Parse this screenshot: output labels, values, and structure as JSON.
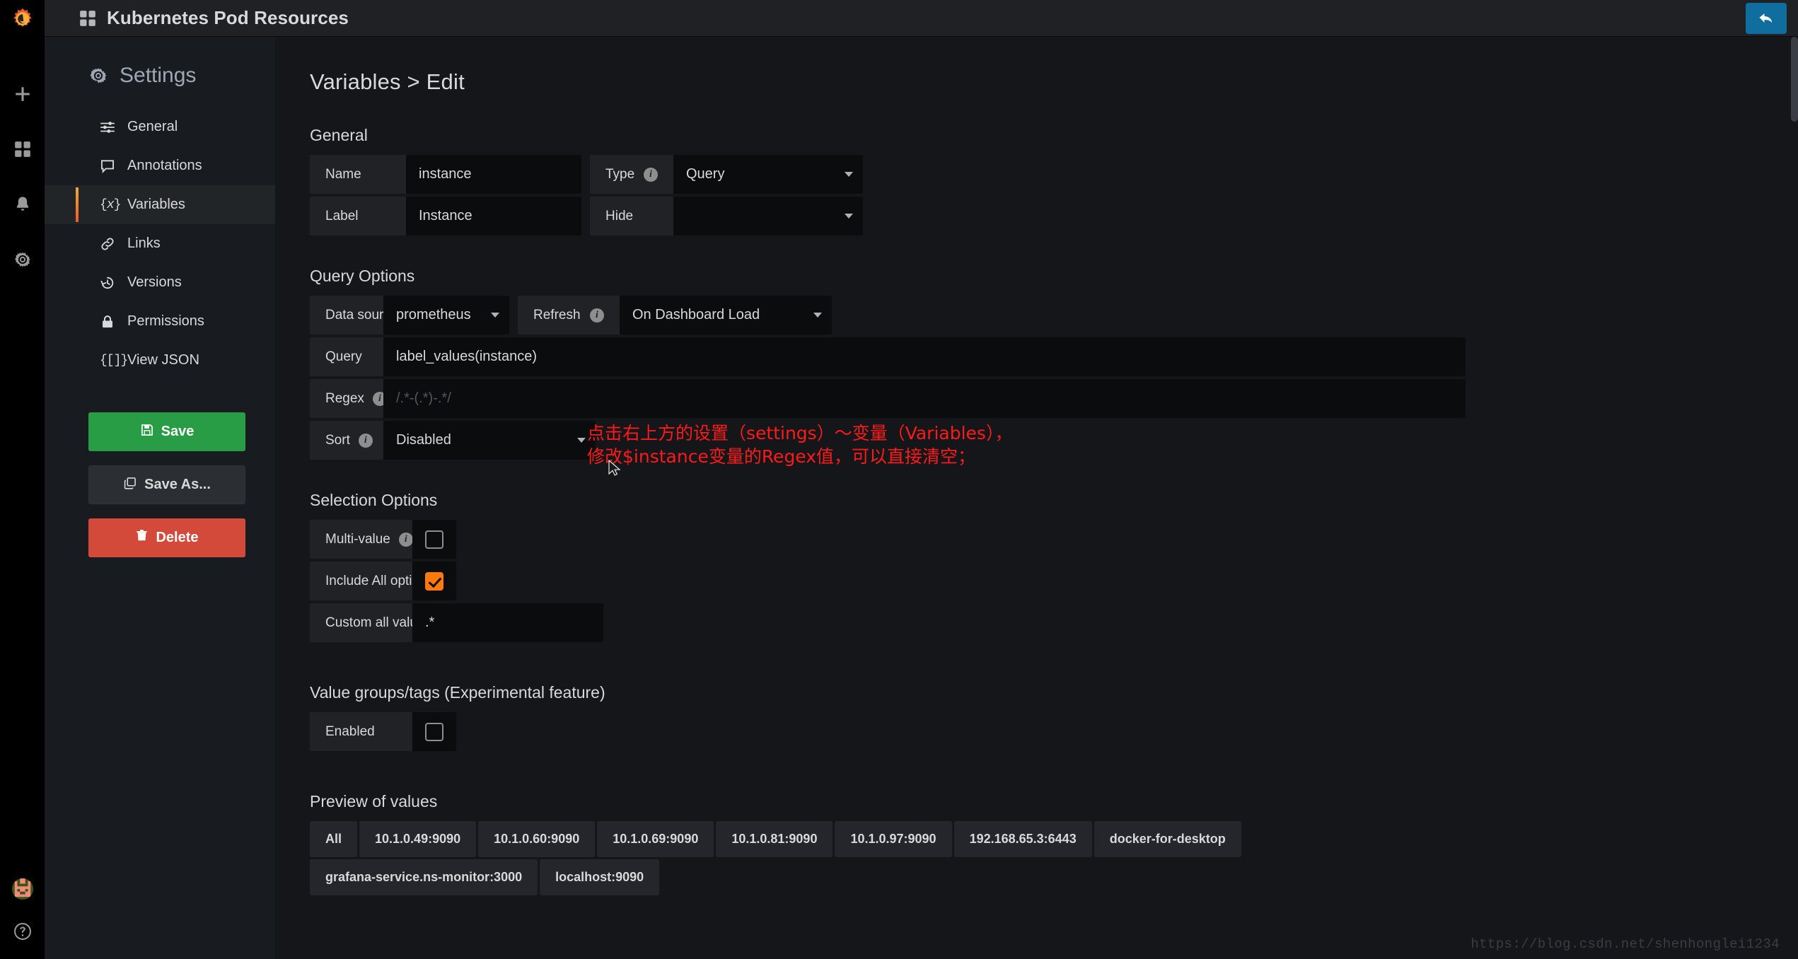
{
  "colors": {
    "accent_orange": "#ff780a",
    "save_green": "#299c46",
    "delete_red": "#d44a3a",
    "back_blue": "#0f6e9e",
    "annotation_red": "#ff1a1a",
    "panel_bg": "#141619",
    "field_bg": "#0b0c0e"
  },
  "rail": {
    "logo_name": "grafana-logo-icon",
    "items": [
      {
        "name": "create-add-icon",
        "label": "Create"
      },
      {
        "name": "dashboards-grid-icon",
        "label": "Dashboards"
      },
      {
        "name": "alerting-bell-icon",
        "label": "Alerting"
      },
      {
        "name": "configuration-gear-icon",
        "label": "Configuration"
      }
    ],
    "bottom": [
      {
        "name": "user-avatar",
        "label": "User profile"
      },
      {
        "name": "help-question-icon",
        "label": "Help"
      }
    ]
  },
  "topbar": {
    "dashboard_icon": "dashboard-grid-icon",
    "title": "Kubernetes Pod Resources",
    "back_button_label": "Go back to dashboard",
    "back_icon": "back-arrow-icon"
  },
  "sidebar": {
    "heading": "Settings",
    "heading_icon": "gear-icon",
    "items": [
      {
        "label": "General",
        "icon": "sliders-icon",
        "active": false
      },
      {
        "label": "Annotations",
        "icon": "comment-icon",
        "active": false
      },
      {
        "label": "Variables",
        "icon": "variable-icon",
        "active": true
      },
      {
        "label": "Links",
        "icon": "link-icon",
        "active": false
      },
      {
        "label": "Versions",
        "icon": "history-icon",
        "active": false
      },
      {
        "label": "Permissions",
        "icon": "lock-icon",
        "active": false
      },
      {
        "label": "View JSON",
        "icon": "json-brackets-icon",
        "active": false
      }
    ],
    "actions": {
      "save": "Save",
      "save_as": "Save As...",
      "delete": "Delete"
    }
  },
  "main": {
    "page_title": "Variables > Edit",
    "general": {
      "heading": "General",
      "name_label": "Name",
      "name_value": "instance",
      "type_label": "Type",
      "type_value": "Query",
      "label_label": "Label",
      "label_value": "Instance",
      "hide_label": "Hide",
      "hide_value": ""
    },
    "query_options": {
      "heading": "Query Options",
      "datasource_label": "Data source",
      "datasource_value": "prometheus",
      "refresh_label": "Refresh",
      "refresh_value": "On Dashboard Load",
      "query_label": "Query",
      "query_value": "label_values(instance)",
      "regex_label": "Regex",
      "regex_value": "",
      "regex_placeholder": "/.*-(.*)-.*/",
      "sort_label": "Sort",
      "sort_value": "Disabled"
    },
    "selection_options": {
      "heading": "Selection Options",
      "multi_value_label": "Multi-value",
      "multi_value_checked": false,
      "include_all_label": "Include All option",
      "include_all_checked": true,
      "custom_all_label": "Custom all value",
      "custom_all_value": ".*"
    },
    "value_groups": {
      "heading": "Value groups/tags (Experimental feature)",
      "enabled_label": "Enabled",
      "enabled_checked": false
    },
    "preview": {
      "heading": "Preview of values",
      "values": [
        "All",
        "10.1.0.49:9090",
        "10.1.0.60:9090",
        "10.1.0.69:9090",
        "10.1.0.81:9090",
        "10.1.0.97:9090",
        "192.168.65.3:6443",
        "docker-for-desktop",
        "grafana-service.ns-monitor:3000",
        "localhost:9090"
      ]
    }
  },
  "annotation": {
    "line1": "点击右上方的设置（settings）～变量（Variables），",
    "line2": "修改$instance变量的Regex值，可以直接清空；"
  },
  "watermark": "https://blog.csdn.net/shenhonglei1234"
}
